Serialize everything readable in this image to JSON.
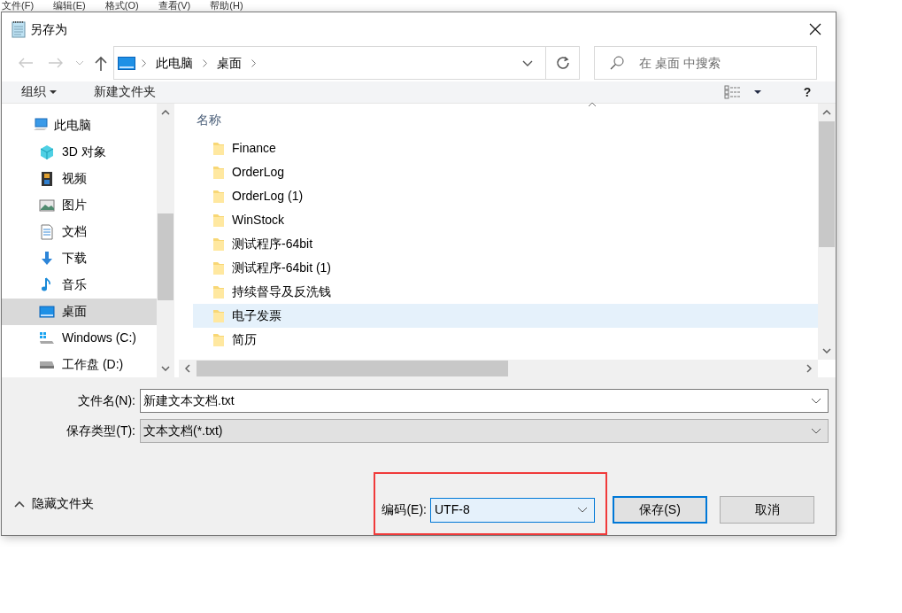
{
  "background_menu": [
    "文件(F)",
    "编辑(E)",
    "格式(O)",
    "查看(V)",
    "帮助(H)"
  ],
  "window": {
    "title": "另存为"
  },
  "navigation": {
    "back_disabled": true,
    "forward_disabled": true,
    "breadcrumb": [
      "此电脑",
      "桌面"
    ],
    "search": {
      "placeholder": "在 桌面 中搜索"
    }
  },
  "toolbar": {
    "organize": "组织",
    "new_folder": "新建文件夹",
    "help": "?"
  },
  "nav_pane": [
    {
      "label": "此电脑",
      "kind": "pc",
      "selected": false,
      "children": [
        {
          "label": "3D 对象",
          "kind": "cube",
          "selected": false
        },
        {
          "label": "视频",
          "kind": "video",
          "selected": false
        },
        {
          "label": "图片",
          "kind": "image",
          "selected": false
        },
        {
          "label": "文档",
          "kind": "document",
          "selected": false
        },
        {
          "label": "下载",
          "kind": "download",
          "selected": false
        },
        {
          "label": "音乐",
          "kind": "music",
          "selected": false
        },
        {
          "label": "桌面",
          "kind": "desktop",
          "selected": true
        },
        {
          "label": "Windows (C:)",
          "kind": "system-drive",
          "selected": false
        },
        {
          "label": "工作盘 (D:)",
          "kind": "drive",
          "selected": false
        }
      ]
    }
  ],
  "file_list": {
    "column": "名称",
    "items": [
      {
        "name": "Finance",
        "selected": false
      },
      {
        "name": "OrderLog",
        "selected": false
      },
      {
        "name": "OrderLog (1)",
        "selected": false
      },
      {
        "name": "WinStock",
        "selected": false
      },
      {
        "name": "测试程序-64bit",
        "selected": false
      },
      {
        "name": "测试程序-64bit (1)",
        "selected": false
      },
      {
        "name": "持续督导及反洗钱",
        "selected": false
      },
      {
        "name": "电子发票",
        "selected": true
      },
      {
        "name": "简历",
        "selected": false
      }
    ]
  },
  "form": {
    "filename_label": "文件名(N):",
    "filename": "新建文本文档.txt",
    "type_label": "保存类型(T):",
    "type": "文本文档(*.txt)",
    "encoding_label": "编码(E):",
    "encoding": "UTF-8",
    "encoding_highlighted": true
  },
  "hide_folders": "隐藏文件夹",
  "buttons": [
    {
      "label": "保存(S)",
      "default": true
    },
    {
      "label": "取消",
      "default": false
    }
  ]
}
